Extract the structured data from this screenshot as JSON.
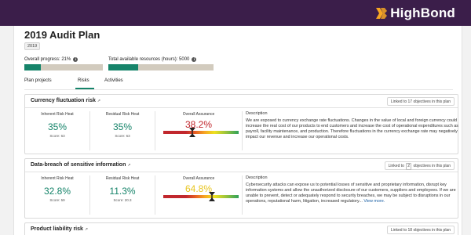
{
  "brand": {
    "name": "HighBond",
    "accent": "#3b1e4a",
    "logo_color": "#f6a623"
  },
  "page": {
    "title": "2019 Audit Plan",
    "year_badge": "2019"
  },
  "progress": {
    "overall_label": "Overall progress: 21%",
    "overall_value": 0.21,
    "resources_label": "Total available resources (hours): 5000",
    "resources_value": 0.28
  },
  "tabs": [
    {
      "label": "Plan projects"
    },
    {
      "label": "Risks",
      "active": true
    },
    {
      "label": "Activities"
    }
  ],
  "labels": {
    "inherent": "Inherent Risk Heat",
    "residual": "Residual Risk Heat",
    "assurance": "Overall Assurance",
    "description": "Description",
    "linked_prefix": "Linked to",
    "linked_suffix": "objectives in this plan"
  },
  "risks": [
    {
      "title": "Currency fluctuation risk",
      "linked_count": "17",
      "inherent_value": "35%",
      "inherent_score": "Score: 63",
      "residual_value": "35%",
      "residual_score": "Score: 63",
      "assurance_value": "38.2%",
      "assurance_level": 0.382,
      "assurance_color": "#c1272d",
      "description": "We are exposed to currency exchange rate fluctuations. Changes in the value of local and foreign currency could increase the real cost of our products to end customers and increase the cost of operational expenditures such as payroll, facility maintenance, and production. Therefore fluctuations in the currency exchange rate may negatively impact our revenue and increase our operational costs.",
      "view_more": ""
    },
    {
      "title": "Data-breach of sensitive information",
      "linked_count": "2",
      "inherent_value": "32.8%",
      "inherent_score": "Score: 59",
      "residual_value": "11.3%",
      "residual_score": "Score: 20.3",
      "assurance_value": "64.8%",
      "assurance_level": 0.648,
      "assurance_color": "#e8c51f",
      "description": "Cybersecurity attacks can expose us to potential losses of sensitive and proprietary information, disrupt key information systems and allow the unauthorized disclosure of our customers, suppliers and employees. If we are unable to prevent, detect or adequately respond to security breaches, we may be subject to disruptions in our operations, reputational harm, litigation, increased regulatory...",
      "view_more": "View more."
    },
    {
      "title": "Product liability risk",
      "linked_count": "18"
    }
  ]
}
